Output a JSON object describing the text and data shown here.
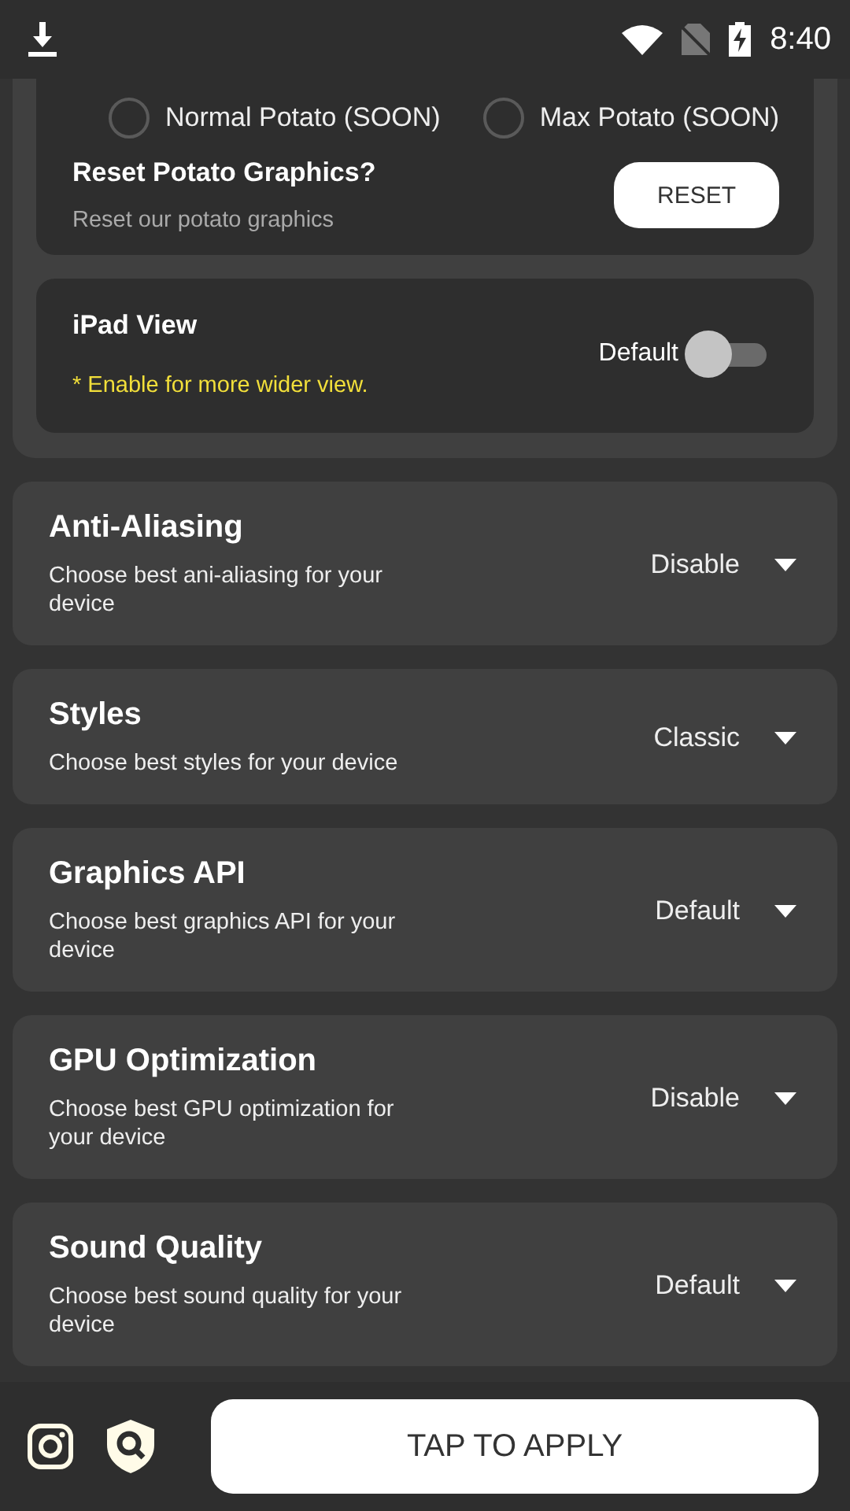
{
  "status_bar": {
    "time": "8:40"
  },
  "potato_panel": {
    "options": [
      {
        "label": "Normal Potato (SOON)",
        "selected": false
      },
      {
        "label": "Max Potato (SOON)",
        "selected": false
      }
    ],
    "reset": {
      "title": "Reset Potato  Graphics?",
      "subtitle": "Reset our potato graphics",
      "button": "RESET"
    }
  },
  "ipad_view": {
    "title": "iPad View",
    "hint": "* Enable for more wider view.",
    "toggle_label": "Default",
    "on": false
  },
  "settings": [
    {
      "title": "Anti-Aliasing",
      "description": "Choose best ani-aliasing for your device",
      "value": "Disable"
    },
    {
      "title": "Styles",
      "description": "Choose best styles for your device",
      "value": "Classic"
    },
    {
      "title": "Graphics API",
      "description": "Choose best graphics API for your device",
      "value": "Default"
    },
    {
      "title": "GPU Optimization",
      "description": "Choose best GPU optimization for your device",
      "value": "Disable"
    },
    {
      "title": "Sound Quality",
      "description": "Choose best sound quality for your device",
      "value": "Default"
    }
  ],
  "bottom_bar": {
    "apply_button": "TAP TO APPLY"
  }
}
